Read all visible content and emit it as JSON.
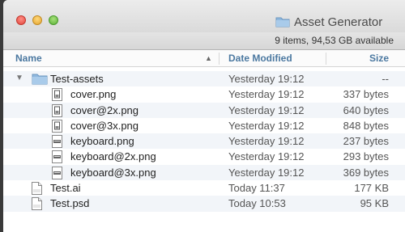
{
  "window": {
    "title": "Asset Generator",
    "status": "9 items, 94,53 GB available"
  },
  "columns": {
    "name": "Name",
    "date": "Date Modified",
    "size": "Size",
    "sort_indicator": "▲"
  },
  "rows": [
    {
      "name": "Test-assets",
      "date": "Yesterday 19:12",
      "size": "--",
      "kind": "folder",
      "indent": 0,
      "expanded": true
    },
    {
      "name": "cover.png",
      "date": "Yesterday 19:12",
      "size": "337 bytes",
      "kind": "png-tall",
      "indent": 1
    },
    {
      "name": "cover@2x.png",
      "date": "Yesterday 19:12",
      "size": "640 bytes",
      "kind": "png-tall",
      "indent": 1
    },
    {
      "name": "cover@3x.png",
      "date": "Yesterday 19:12",
      "size": "848 bytes",
      "kind": "png-tall",
      "indent": 1
    },
    {
      "name": "keyboard.png",
      "date": "Yesterday 19:12",
      "size": "237 bytes",
      "kind": "png-wide",
      "indent": 1
    },
    {
      "name": "keyboard@2x.png",
      "date": "Yesterday 19:12",
      "size": "293 bytes",
      "kind": "png-wide",
      "indent": 1
    },
    {
      "name": "keyboard@3x.png",
      "date": "Yesterday 19:12",
      "size": "369 bytes",
      "kind": "png-wide",
      "indent": 1
    },
    {
      "name": "Test.ai",
      "date": "Today 11:37",
      "size": "177 KB",
      "kind": "document",
      "indent": 0
    },
    {
      "name": "Test.psd",
      "date": "Today 10:53",
      "size": "95 KB",
      "kind": "document",
      "indent": 0
    }
  ]
}
